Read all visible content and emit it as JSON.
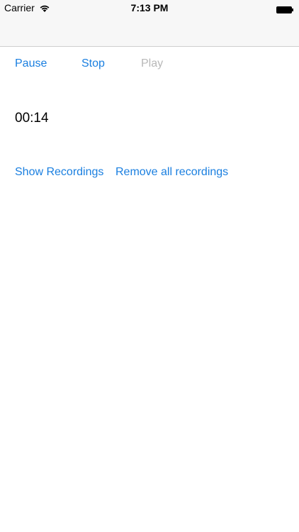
{
  "status_bar": {
    "carrier": "Carrier",
    "time": "7:13 PM",
    "wifi_icon": "wifi-icon",
    "battery_icon": "battery-icon"
  },
  "controls": {
    "pause_label": "Pause",
    "stop_label": "Stop",
    "play_label": "Play"
  },
  "timer": {
    "value": "00:14"
  },
  "links": {
    "show_recordings_label": "Show Recordings",
    "remove_all_label": "Remove all recordings"
  },
  "colors": {
    "accent": "#1a7fe0",
    "disabled": "#b8b8b8",
    "nav_background": "#f7f7f7"
  }
}
